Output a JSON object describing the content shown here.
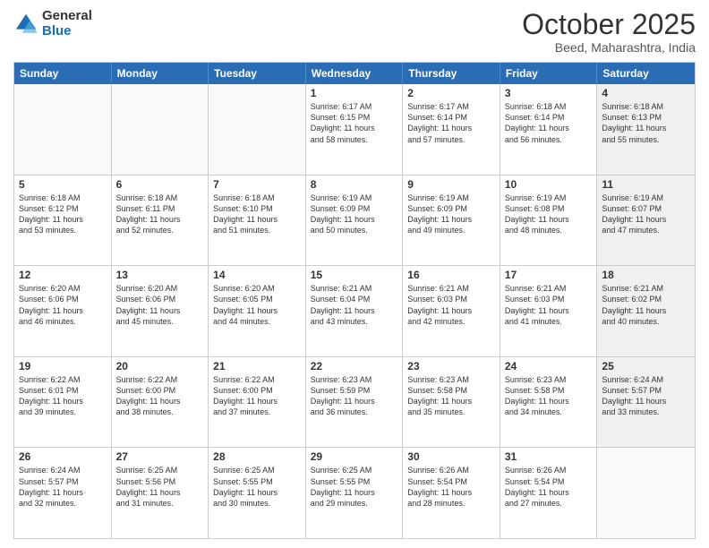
{
  "logo": {
    "general": "General",
    "blue": "Blue"
  },
  "title": "October 2025",
  "location": "Beed, Maharashtra, India",
  "header_days": [
    "Sunday",
    "Monday",
    "Tuesday",
    "Wednesday",
    "Thursday",
    "Friday",
    "Saturday"
  ],
  "rows": [
    [
      {
        "day": "",
        "info": "",
        "empty": true
      },
      {
        "day": "",
        "info": "",
        "empty": true
      },
      {
        "day": "",
        "info": "",
        "empty": true
      },
      {
        "day": "1",
        "info": "Sunrise: 6:17 AM\nSunset: 6:15 PM\nDaylight: 11 hours\nand 58 minutes.",
        "empty": false
      },
      {
        "day": "2",
        "info": "Sunrise: 6:17 AM\nSunset: 6:14 PM\nDaylight: 11 hours\nand 57 minutes.",
        "empty": false
      },
      {
        "day": "3",
        "info": "Sunrise: 6:18 AM\nSunset: 6:14 PM\nDaylight: 11 hours\nand 56 minutes.",
        "empty": false
      },
      {
        "day": "4",
        "info": "Sunrise: 6:18 AM\nSunset: 6:13 PM\nDaylight: 11 hours\nand 55 minutes.",
        "empty": false,
        "shaded": true
      }
    ],
    [
      {
        "day": "5",
        "info": "Sunrise: 6:18 AM\nSunset: 6:12 PM\nDaylight: 11 hours\nand 53 minutes.",
        "empty": false
      },
      {
        "day": "6",
        "info": "Sunrise: 6:18 AM\nSunset: 6:11 PM\nDaylight: 11 hours\nand 52 minutes.",
        "empty": false
      },
      {
        "day": "7",
        "info": "Sunrise: 6:18 AM\nSunset: 6:10 PM\nDaylight: 11 hours\nand 51 minutes.",
        "empty": false
      },
      {
        "day": "8",
        "info": "Sunrise: 6:19 AM\nSunset: 6:09 PM\nDaylight: 11 hours\nand 50 minutes.",
        "empty": false
      },
      {
        "day": "9",
        "info": "Sunrise: 6:19 AM\nSunset: 6:09 PM\nDaylight: 11 hours\nand 49 minutes.",
        "empty": false
      },
      {
        "day": "10",
        "info": "Sunrise: 6:19 AM\nSunset: 6:08 PM\nDaylight: 11 hours\nand 48 minutes.",
        "empty": false
      },
      {
        "day": "11",
        "info": "Sunrise: 6:19 AM\nSunset: 6:07 PM\nDaylight: 11 hours\nand 47 minutes.",
        "empty": false,
        "shaded": true
      }
    ],
    [
      {
        "day": "12",
        "info": "Sunrise: 6:20 AM\nSunset: 6:06 PM\nDaylight: 11 hours\nand 46 minutes.",
        "empty": false
      },
      {
        "day": "13",
        "info": "Sunrise: 6:20 AM\nSunset: 6:06 PM\nDaylight: 11 hours\nand 45 minutes.",
        "empty": false
      },
      {
        "day": "14",
        "info": "Sunrise: 6:20 AM\nSunset: 6:05 PM\nDaylight: 11 hours\nand 44 minutes.",
        "empty": false
      },
      {
        "day": "15",
        "info": "Sunrise: 6:21 AM\nSunset: 6:04 PM\nDaylight: 11 hours\nand 43 minutes.",
        "empty": false
      },
      {
        "day": "16",
        "info": "Sunrise: 6:21 AM\nSunset: 6:03 PM\nDaylight: 11 hours\nand 42 minutes.",
        "empty": false
      },
      {
        "day": "17",
        "info": "Sunrise: 6:21 AM\nSunset: 6:03 PM\nDaylight: 11 hours\nand 41 minutes.",
        "empty": false
      },
      {
        "day": "18",
        "info": "Sunrise: 6:21 AM\nSunset: 6:02 PM\nDaylight: 11 hours\nand 40 minutes.",
        "empty": false,
        "shaded": true
      }
    ],
    [
      {
        "day": "19",
        "info": "Sunrise: 6:22 AM\nSunset: 6:01 PM\nDaylight: 11 hours\nand 39 minutes.",
        "empty": false
      },
      {
        "day": "20",
        "info": "Sunrise: 6:22 AM\nSunset: 6:00 PM\nDaylight: 11 hours\nand 38 minutes.",
        "empty": false
      },
      {
        "day": "21",
        "info": "Sunrise: 6:22 AM\nSunset: 6:00 PM\nDaylight: 11 hours\nand 37 minutes.",
        "empty": false
      },
      {
        "day": "22",
        "info": "Sunrise: 6:23 AM\nSunset: 5:59 PM\nDaylight: 11 hours\nand 36 minutes.",
        "empty": false
      },
      {
        "day": "23",
        "info": "Sunrise: 6:23 AM\nSunset: 5:58 PM\nDaylight: 11 hours\nand 35 minutes.",
        "empty": false
      },
      {
        "day": "24",
        "info": "Sunrise: 6:23 AM\nSunset: 5:58 PM\nDaylight: 11 hours\nand 34 minutes.",
        "empty": false
      },
      {
        "day": "25",
        "info": "Sunrise: 6:24 AM\nSunset: 5:57 PM\nDaylight: 11 hours\nand 33 minutes.",
        "empty": false,
        "shaded": true
      }
    ],
    [
      {
        "day": "26",
        "info": "Sunrise: 6:24 AM\nSunset: 5:57 PM\nDaylight: 11 hours\nand 32 minutes.",
        "empty": false
      },
      {
        "day": "27",
        "info": "Sunrise: 6:25 AM\nSunset: 5:56 PM\nDaylight: 11 hours\nand 31 minutes.",
        "empty": false
      },
      {
        "day": "28",
        "info": "Sunrise: 6:25 AM\nSunset: 5:55 PM\nDaylight: 11 hours\nand 30 minutes.",
        "empty": false
      },
      {
        "day": "29",
        "info": "Sunrise: 6:25 AM\nSunset: 5:55 PM\nDaylight: 11 hours\nand 29 minutes.",
        "empty": false
      },
      {
        "day": "30",
        "info": "Sunrise: 6:26 AM\nSunset: 5:54 PM\nDaylight: 11 hours\nand 28 minutes.",
        "empty": false
      },
      {
        "day": "31",
        "info": "Sunrise: 6:26 AM\nSunset: 5:54 PM\nDaylight: 11 hours\nand 27 minutes.",
        "empty": false
      },
      {
        "day": "",
        "info": "",
        "empty": true,
        "shaded": true
      }
    ]
  ]
}
